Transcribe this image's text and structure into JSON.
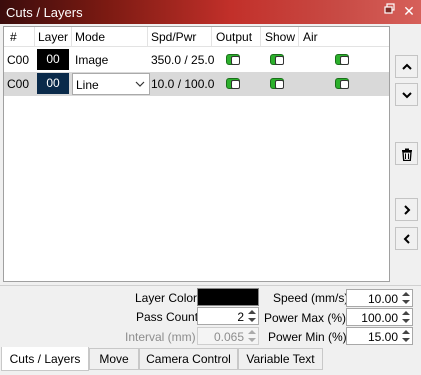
{
  "window": {
    "title": "Cuts / Layers",
    "restore_icon": "restore-window-icon",
    "close_icon": "close-icon"
  },
  "grid": {
    "columns": [
      "#",
      "Layer",
      "Mode",
      "Spd/Pwr",
      "Output",
      "Show",
      "Air"
    ],
    "rows": [
      {
        "num": "C00",
        "layer": "00",
        "layer_color": "#000000",
        "mode": "Image",
        "spd_pwr": "350.0 / 25.0",
        "output": true,
        "show": true,
        "air": true
      },
      {
        "num": "C00",
        "layer": "00",
        "layer_color": "#0a2a4a",
        "mode": "Line",
        "spd_pwr": "10.0 / 100.0",
        "output": true,
        "show": true,
        "air": true
      }
    ]
  },
  "side_buttons": [
    {
      "name": "move-up-button",
      "icon": "chevron-up-icon"
    },
    {
      "name": "move-down-button",
      "icon": "chevron-down-icon"
    },
    {
      "name": "delete-button",
      "icon": "trash-icon"
    },
    {
      "name": "expand-button",
      "icon": "chevron-right-icon"
    },
    {
      "name": "collapse-button",
      "icon": "chevron-left-icon"
    }
  ],
  "settings": {
    "layer_color_label": "Layer Color",
    "layer_color": "#000000",
    "pass_count_label": "Pass Count",
    "pass_count": "2",
    "interval_label": "Interval (mm)",
    "interval": "0.065",
    "speed_label": "Speed (mm/s)",
    "speed": "10.00",
    "power_max_label": "Power Max (%)",
    "power_max": "100.00",
    "power_min_label": "Power Min (%)",
    "power_min": "15.00"
  },
  "tabs": [
    "Cuts / Layers",
    "Move",
    "Camera Control",
    "Variable Text"
  ],
  "active_tab": 0
}
